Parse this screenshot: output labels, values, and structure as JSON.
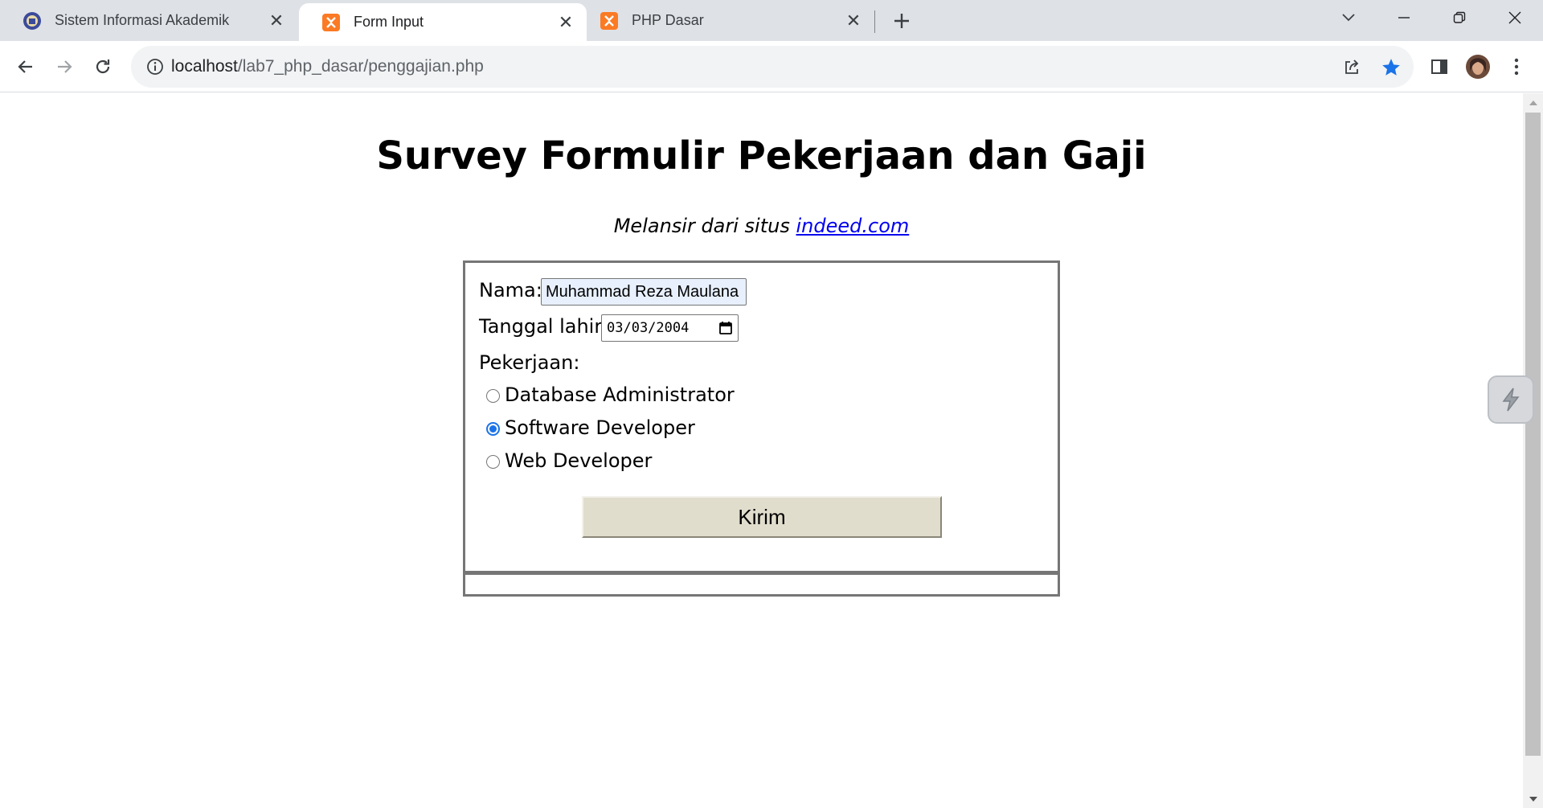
{
  "browser": {
    "tabs": [
      {
        "title": "Sistem Informasi Akademik",
        "icon": "university-logo-icon",
        "active": false
      },
      {
        "title": "Form Input",
        "icon": "xampp-icon",
        "active": true
      },
      {
        "title": "PHP Dasar",
        "icon": "xampp-icon",
        "active": false
      }
    ],
    "url_host": "localhost",
    "url_path": "/lab7_php_dasar/penggajian.php"
  },
  "page": {
    "title": "Survey Formulir Pekerjaan dan Gaji",
    "subtitle_prefix": "Melansir dari situs",
    "subtitle_link": "indeed.com"
  },
  "form": {
    "nama_label": "Nama:",
    "nama_value": "Muhammad Reza Maulana",
    "tanggal_label": "Tanggal lahir:",
    "tanggal_value": "03/03/2004",
    "pekerjaan_label": "Pekerjaan:",
    "options": [
      {
        "label": "Database Administrator",
        "selected": false
      },
      {
        "label": "Software Developer",
        "selected": true
      },
      {
        "label": "Web Developer",
        "selected": false
      }
    ],
    "submit_label": "Kirim"
  },
  "colors": {
    "accent": "#1a73e8",
    "link": "#0000ee",
    "button_bg": "#e1ddcd",
    "autofill_bg": "#e8f0fe"
  }
}
